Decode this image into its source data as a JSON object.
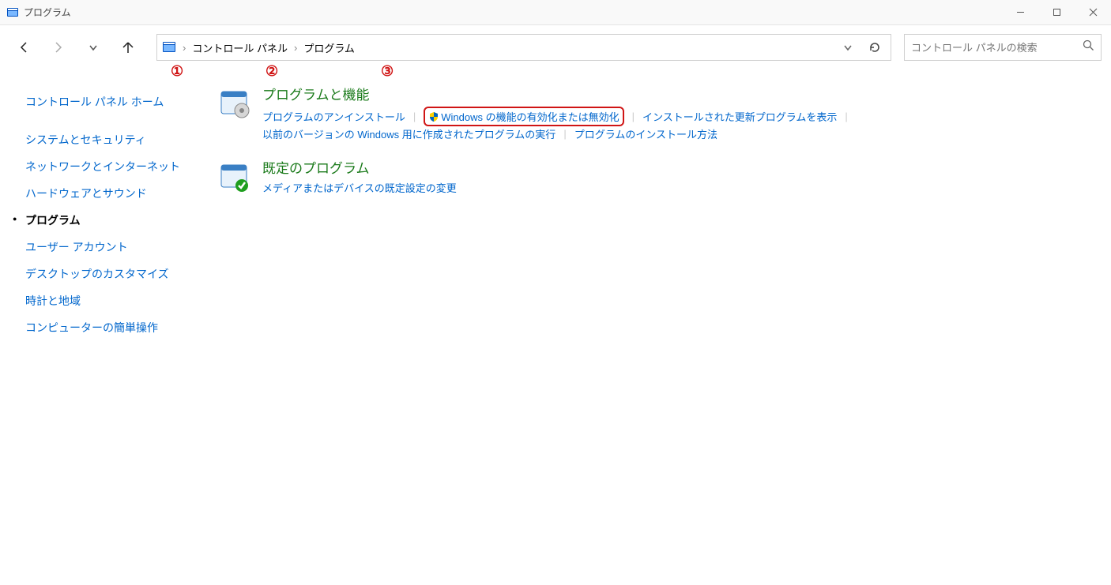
{
  "window": {
    "title": "プログラム"
  },
  "toolbar": {
    "breadcrumbs": [
      "コントロール パネル",
      "プログラム"
    ],
    "search_placeholder": "コントロール パネルの検索"
  },
  "sidebar": {
    "items": [
      {
        "label": "コントロール パネル ホーム",
        "current": false
      },
      {
        "label": "システムとセキュリティ",
        "current": false
      },
      {
        "label": "ネットワークとインターネット",
        "current": false
      },
      {
        "label": "ハードウェアとサウンド",
        "current": false
      },
      {
        "label": "プログラム",
        "current": true
      },
      {
        "label": "ユーザー アカウント",
        "current": false
      },
      {
        "label": "デスクトップのカスタマイズ",
        "current": false
      },
      {
        "label": "時計と地域",
        "current": false
      },
      {
        "label": "コンピューターの簡単操作",
        "current": false
      }
    ]
  },
  "main": {
    "categories": [
      {
        "title": "プログラムと機能",
        "links_row1": [
          {
            "label": "プログラムのアンインストール",
            "shield": false,
            "highlight": false
          },
          {
            "label": "Windows の機能の有効化または無効化",
            "shield": true,
            "highlight": true
          },
          {
            "label": "インストールされた更新プログラムを表示",
            "shield": false,
            "highlight": false
          }
        ],
        "links_row2": [
          {
            "label": "以前のバージョンの Windows 用に作成されたプログラムの実行",
            "shield": false
          },
          {
            "label": "プログラムのインストール方法",
            "shield": false
          }
        ]
      },
      {
        "title": "既定のプログラム",
        "links_row1": [
          {
            "label": "メディアまたはデバイスの既定設定の変更",
            "shield": false
          }
        ],
        "links_row2": []
      }
    ]
  },
  "annotations": [
    "①",
    "②",
    "③"
  ]
}
